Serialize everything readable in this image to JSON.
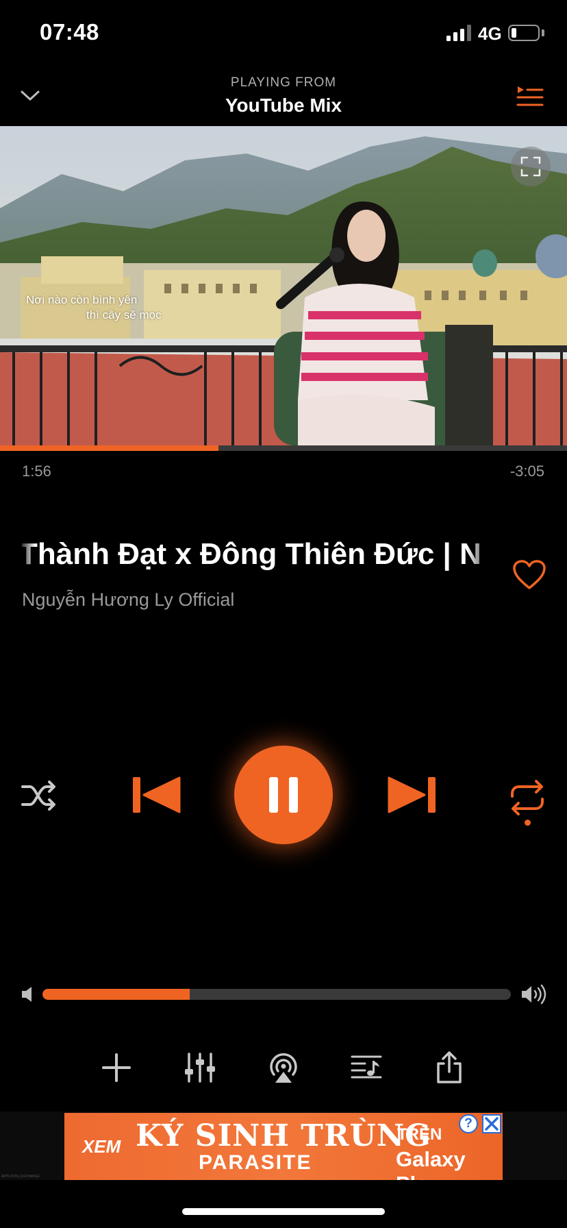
{
  "status_bar": {
    "time": "07:48",
    "network": "4G",
    "battery_level": 0.2
  },
  "header": {
    "subtitle": "PLAYING FROM",
    "title": "YouTube Mix"
  },
  "video": {
    "lyric_line_1": "Nơi nào còn bình yên",
    "lyric_line_2": "thì cây sẽ mọc"
  },
  "playback": {
    "elapsed": "1:56",
    "remaining": "-3:05",
    "progress": 0.385
  },
  "track": {
    "title": "Thành Đạt x Đông Thiên Đức | N",
    "artist": "Nguyễn Hương Ly Official"
  },
  "volume": {
    "level": 0.315
  },
  "icons": {
    "collapse": "chevron-down-icon",
    "queue": "queue-list-icon",
    "expand": "fullscreen-icon",
    "like": "heart-icon",
    "shuffle": "shuffle-icon",
    "previous": "previous-track-icon",
    "play": "pause-icon",
    "next": "next-track-icon",
    "repeat": "repeat-icon",
    "add": "plus-icon",
    "equalizer": "sliders-icon",
    "airplay": "airplay-icon",
    "lyrics": "music-list-icon",
    "share": "share-icon"
  },
  "colors": {
    "accent": "#f06423",
    "background": "#000000",
    "muted_text": "#9a9a9a"
  },
  "ad": {
    "xem": "XEM",
    "title": "KÝ SINH TRÙNG",
    "subtitle": "PARASITE",
    "tren": "TRÊN",
    "brand": "Galaxy Play",
    "info": "?",
    "tiny_text": "APPLOVIN_EXCHANGE"
  }
}
